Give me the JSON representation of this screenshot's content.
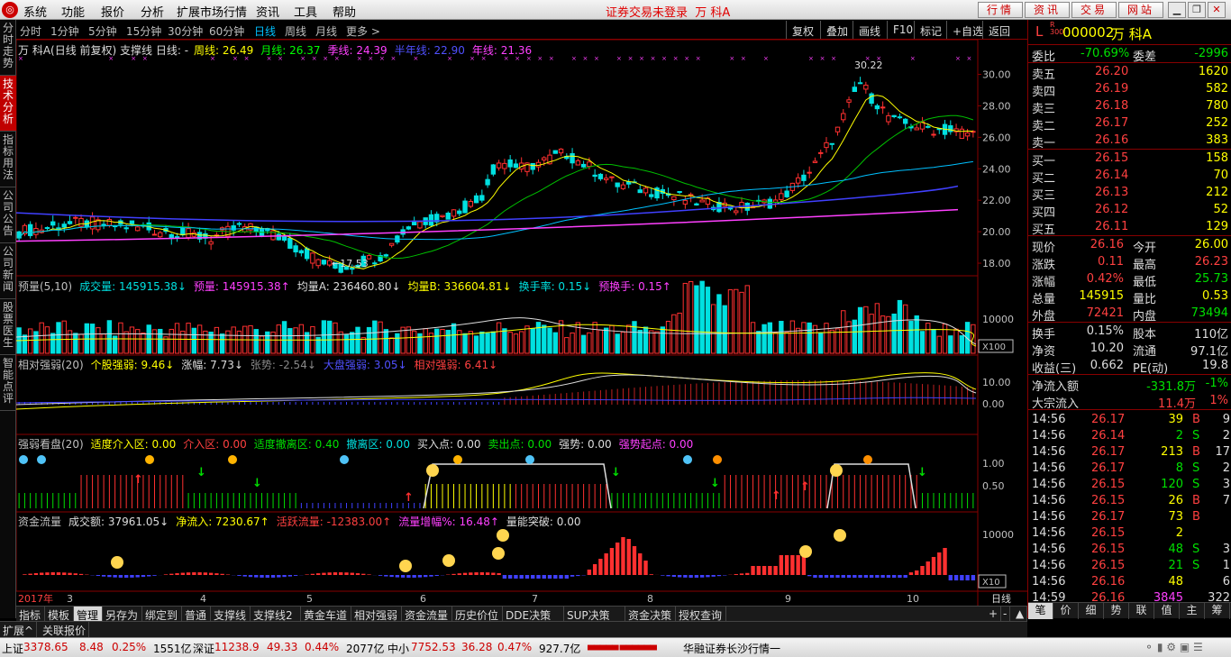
{
  "menu": {
    "items": [
      "系统",
      "功能",
      "报价",
      "分析",
      "扩展市场行情",
      "资讯",
      "工具",
      "帮助"
    ],
    "center_status": "证券交易未登录",
    "stock_name": "万 科A",
    "right_buttons": [
      "行情",
      "资讯",
      "交易",
      "网站"
    ]
  },
  "left_rail": {
    "tabs": [
      "分时走势",
      "技术分析",
      "指标用法",
      "公司公告",
      "公司新闻",
      "股票医生",
      "智能点评"
    ],
    "active": 1
  },
  "period_bar": {
    "periods": [
      "分时",
      "1分钟",
      "5分钟",
      "15分钟",
      "30分钟",
      "60分钟",
      "日线",
      "周线",
      "月线",
      "更多 >"
    ],
    "active": 6,
    "tools": [
      "复权",
      "叠加",
      "画线",
      "F10",
      "标记",
      "+自选",
      "返回"
    ]
  },
  "main_legend": {
    "title": "万 科A(日线 前复权) 支撑线 日线: -",
    "ma": [
      {
        "label": "周线: 26.49",
        "color": "#ffff00"
      },
      {
        "label": "月线: 26.37",
        "color": "#00ff00"
      },
      {
        "label": "季线: 24.39",
        "color": "#ff40ff"
      },
      {
        "label": "半年线: 22.90",
        "color": "#5050ff"
      },
      {
        "label": "年线: 21.36",
        "color": "#ff40ff"
      }
    ],
    "high_label": "30.22",
    "low_label": "17.53",
    "yticks": [
      "30.00",
      "28.00",
      "26.00",
      "24.00",
      "22.00",
      "20.00",
      "18.00"
    ]
  },
  "vol_legend": {
    "parts": [
      {
        "t": "预量(5,10)",
        "c": "#c0c0c0"
      },
      {
        "t": "成交量: 145915.38↓",
        "c": "#00e0e0"
      },
      {
        "t": "预量: 145915.38↑",
        "c": "#ff40ff"
      },
      {
        "t": "均量A: 236460.80↓",
        "c": "#ddd"
      },
      {
        "t": "均量B: 336604.81↓",
        "c": "#ffff00"
      },
      {
        "t": "换手率: 0.15↓",
        "c": "#00e0e0"
      },
      {
        "t": "预换手: 0.15↑",
        "c": "#ff40ff"
      }
    ],
    "ytick": "10000",
    "unit": "X100"
  },
  "rs_legend": {
    "parts": [
      {
        "t": "相对强弱(20)",
        "c": "#c0c0c0"
      },
      {
        "t": "个股强弱: 9.46↓",
        "c": "#ffff00"
      },
      {
        "t": "涨幅: 7.73↓",
        "c": "#ddd"
      },
      {
        "t": "张势: -2.54↓",
        "c": "#888"
      },
      {
        "t": "大盘强弱: 3.05↓",
        "c": "#5050ff"
      },
      {
        "t": "相对强弱: 6.41↓",
        "c": "#ff4040"
      }
    ],
    "yticks": [
      "10.00",
      "0.00"
    ]
  },
  "qr_legend": {
    "parts": [
      {
        "t": "强弱看盘(20)",
        "c": "#c0c0c0"
      },
      {
        "t": "适度介入区: 0.00",
        "c": "#ffff00"
      },
      {
        "t": "介入区: 0.00",
        "c": "#ff4040"
      },
      {
        "t": "适度撤离区: 0.40",
        "c": "#00e000"
      },
      {
        "t": "撤离区: 0.00",
        "c": "#00e0e0"
      },
      {
        "t": "买入点: 0.00",
        "c": "#ddd"
      },
      {
        "t": "卖出点: 0.00",
        "c": "#00e000"
      },
      {
        "t": "强势: 0.00",
        "c": "#ddd"
      },
      {
        "t": "强势起点: 0.00",
        "c": "#ff40ff"
      }
    ],
    "yticks": [
      "1.00",
      "0.50"
    ]
  },
  "mf_legend": {
    "parts": [
      {
        "t": "资金流量",
        "c": "#c0c0c0"
      },
      {
        "t": "成交额: 37961.05↓",
        "c": "#ddd"
      },
      {
        "t": "净流入: 7230.67↑",
        "c": "#ffff00"
      },
      {
        "t": "活跃流量: -12383.00↑",
        "c": "#ff4040"
      },
      {
        "t": "流量增幅%: 16.48↑",
        "c": "#ff40ff"
      },
      {
        "t": "量能突破: 0.00",
        "c": "#ddd"
      }
    ],
    "ytick": "10000",
    "unit": "X10"
  },
  "xaxis": {
    "labels": [
      "2017年",
      "3",
      "4",
      "5",
      "6",
      "7",
      "8",
      "9",
      "10"
    ],
    "right": "日线"
  },
  "bottom_tabs": {
    "tabs": [
      "指标",
      "模板",
      "管理",
      "另存为",
      "绑定到",
      "普通",
      "支撑线",
      "支撑线2",
      "黄金车道",
      "相对强弱",
      "资金流量",
      "历史价位",
      "DDE决策",
      "SUP决策",
      "资金决策",
      "授权查询"
    ],
    "active": 2,
    "left_tabs": [
      "扩展^",
      "关联报价"
    ]
  },
  "quote": {
    "code": "000002",
    "name": "万 科A",
    "weibi_label": "委比",
    "weibi": "-70.69%",
    "weicha_label": "委差",
    "weicha": "-2996",
    "asks": [
      {
        "l": "卖五",
        "p": "26.20",
        "v": "1620"
      },
      {
        "l": "卖四",
        "p": "26.19",
        "v": "582"
      },
      {
        "l": "卖三",
        "p": "26.18",
        "v": "780"
      },
      {
        "l": "卖二",
        "p": "26.17",
        "v": "252"
      },
      {
        "l": "卖一",
        "p": "26.16",
        "v": "383"
      }
    ],
    "bids": [
      {
        "l": "买一",
        "p": "26.15",
        "v": "158"
      },
      {
        "l": "买二",
        "p": "26.14",
        "v": "70"
      },
      {
        "l": "买三",
        "p": "26.13",
        "v": "212"
      },
      {
        "l": "买四",
        "p": "26.12",
        "v": "52"
      },
      {
        "l": "买五",
        "p": "26.11",
        "v": "129"
      }
    ],
    "stats": [
      {
        "l1": "现价",
        "v1": "26.16",
        "c1": "red",
        "l2": "今开",
        "v2": "26.00",
        "c2": "yel"
      },
      {
        "l1": "涨跌",
        "v1": "0.11",
        "c1": "red",
        "l2": "最高",
        "v2": "26.23",
        "c2": "red"
      },
      {
        "l1": "涨幅",
        "v1": "0.42%",
        "c1": "red",
        "l2": "最低",
        "v2": "25.73",
        "c2": "grn"
      },
      {
        "l1": "总量",
        "v1": "145915",
        "c1": "yel",
        "l2": "量比",
        "v2": "0.53",
        "c2": "yel"
      },
      {
        "l1": "外盘",
        "v1": "72421",
        "c1": "red",
        "l2": "内盘",
        "v2": "73494",
        "c2": "grn"
      }
    ],
    "stats2": [
      {
        "l1": "换手",
        "v1": "0.15%",
        "l2": "股本",
        "v2": "110亿"
      },
      {
        "l1": "净资",
        "v1": "10.20",
        "l2": "流通",
        "v2": "97.1亿"
      },
      {
        "l1": "收益(三)",
        "v1": "0.662",
        "l2": "PE(动)",
        "v2": "19.8"
      }
    ],
    "flow": [
      {
        "l": "净流入额",
        "v": "-331.8万",
        "p": "-1%",
        "c": "grn"
      },
      {
        "l": "大宗流入",
        "v": "11.4万",
        "p": "1%",
        "c": "red"
      }
    ],
    "ticks": [
      [
        "14:56",
        "26.17",
        "39",
        "B",
        "9"
      ],
      [
        "14:56",
        "26.14",
        "2",
        "S",
        "2"
      ],
      [
        "14:56",
        "26.17",
        "213",
        "B",
        "17"
      ],
      [
        "14:56",
        "26.17",
        "8",
        "S",
        "2"
      ],
      [
        "14:56",
        "26.15",
        "120",
        "S",
        "3"
      ],
      [
        "14:56",
        "26.15",
        "26",
        "B",
        "7"
      ],
      [
        "14:56",
        "26.17",
        "73",
        "B",
        ""
      ],
      [
        "14:56",
        "26.15",
        "2",
        "",
        ""
      ],
      [
        "14:56",
        "26.15",
        "48",
        "S",
        "3"
      ],
      [
        "14:56",
        "26.15",
        "21",
        "S",
        "1"
      ],
      [
        "14:56",
        "26.16",
        "48",
        "",
        "6"
      ],
      [
        "14:59",
        "26.16",
        "3845",
        "",
        "322"
      ]
    ],
    "tabs": [
      "笔",
      "价",
      "细",
      "势",
      "联",
      "值",
      "主",
      "筹"
    ]
  },
  "status": {
    "sh_label": "上证",
    "sh": "3378.65",
    "sh_chg": "8.48",
    "sh_pct": "0.25%",
    "sh_amt": "1551亿",
    "sz_label": "深证",
    "sz": "11238.9",
    "sz_chg": "49.33",
    "sz_pct": "0.44%",
    "sz_amt": "2077亿",
    "zx_label": "中小",
    "zx": "7752.53",
    "zx_chg": "36.28",
    "zx_pct": "0.47%",
    "zx_amt": "927.7亿",
    "broker": "华融证券长沙行情一"
  }
}
